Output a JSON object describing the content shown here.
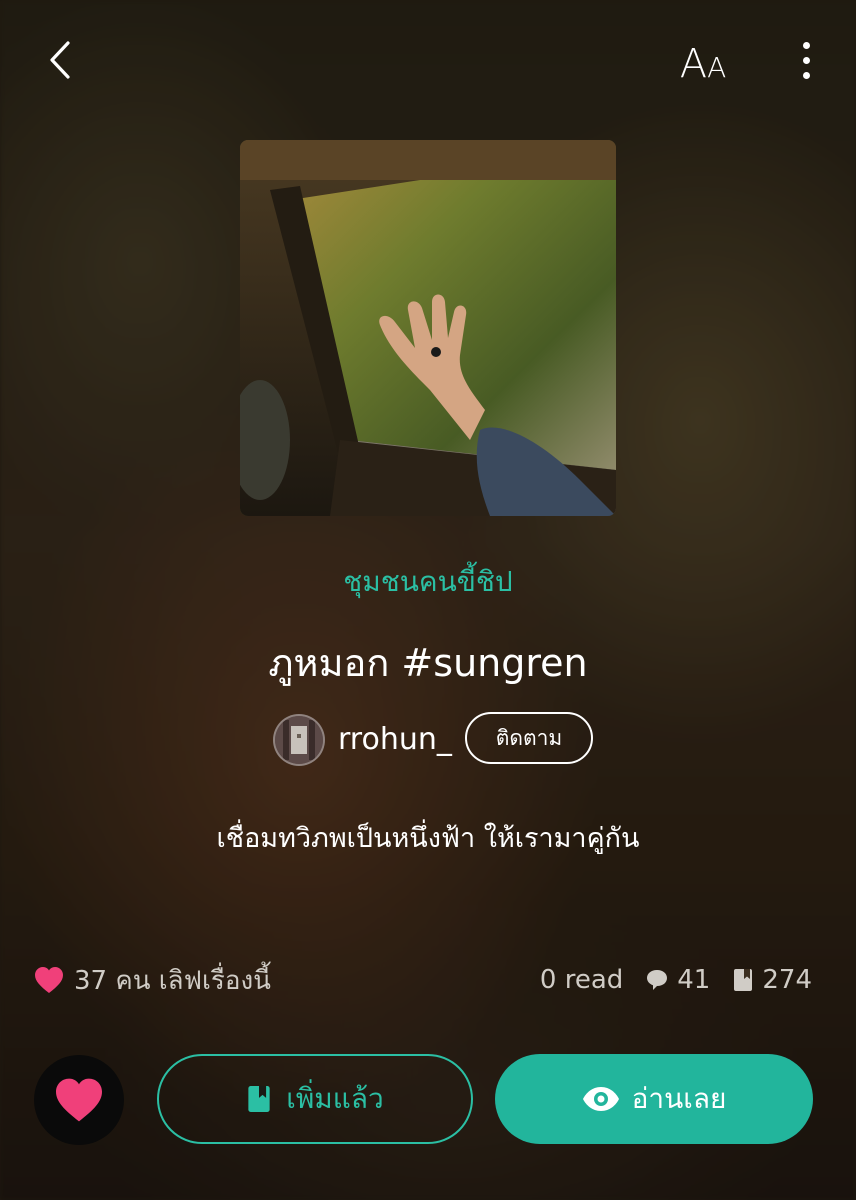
{
  "header": {
    "font_size_label_big": "A",
    "font_size_label_small": "A"
  },
  "story": {
    "community": "ชุมชนคนขี้ชิป",
    "title": "ภูหมอก #sungren",
    "author": "rrohun_",
    "follow_label": "ติดตาม",
    "synopsis": "เชื่อมทวิภพเป็นหนึ่งฟ้า ให้เรามาคู่กัน"
  },
  "stats": {
    "likes_text": "37 คน เลิฟเรื่องนี้",
    "reads_text": "0 read",
    "comments": "41",
    "bookmarks": "274"
  },
  "actions": {
    "added_label": "เพิ่มแล้ว",
    "read_label": "อ่านเลย"
  },
  "colors": {
    "accent": "#2bbfa4",
    "read_button": "#22b59c",
    "love": "#f0407a"
  }
}
